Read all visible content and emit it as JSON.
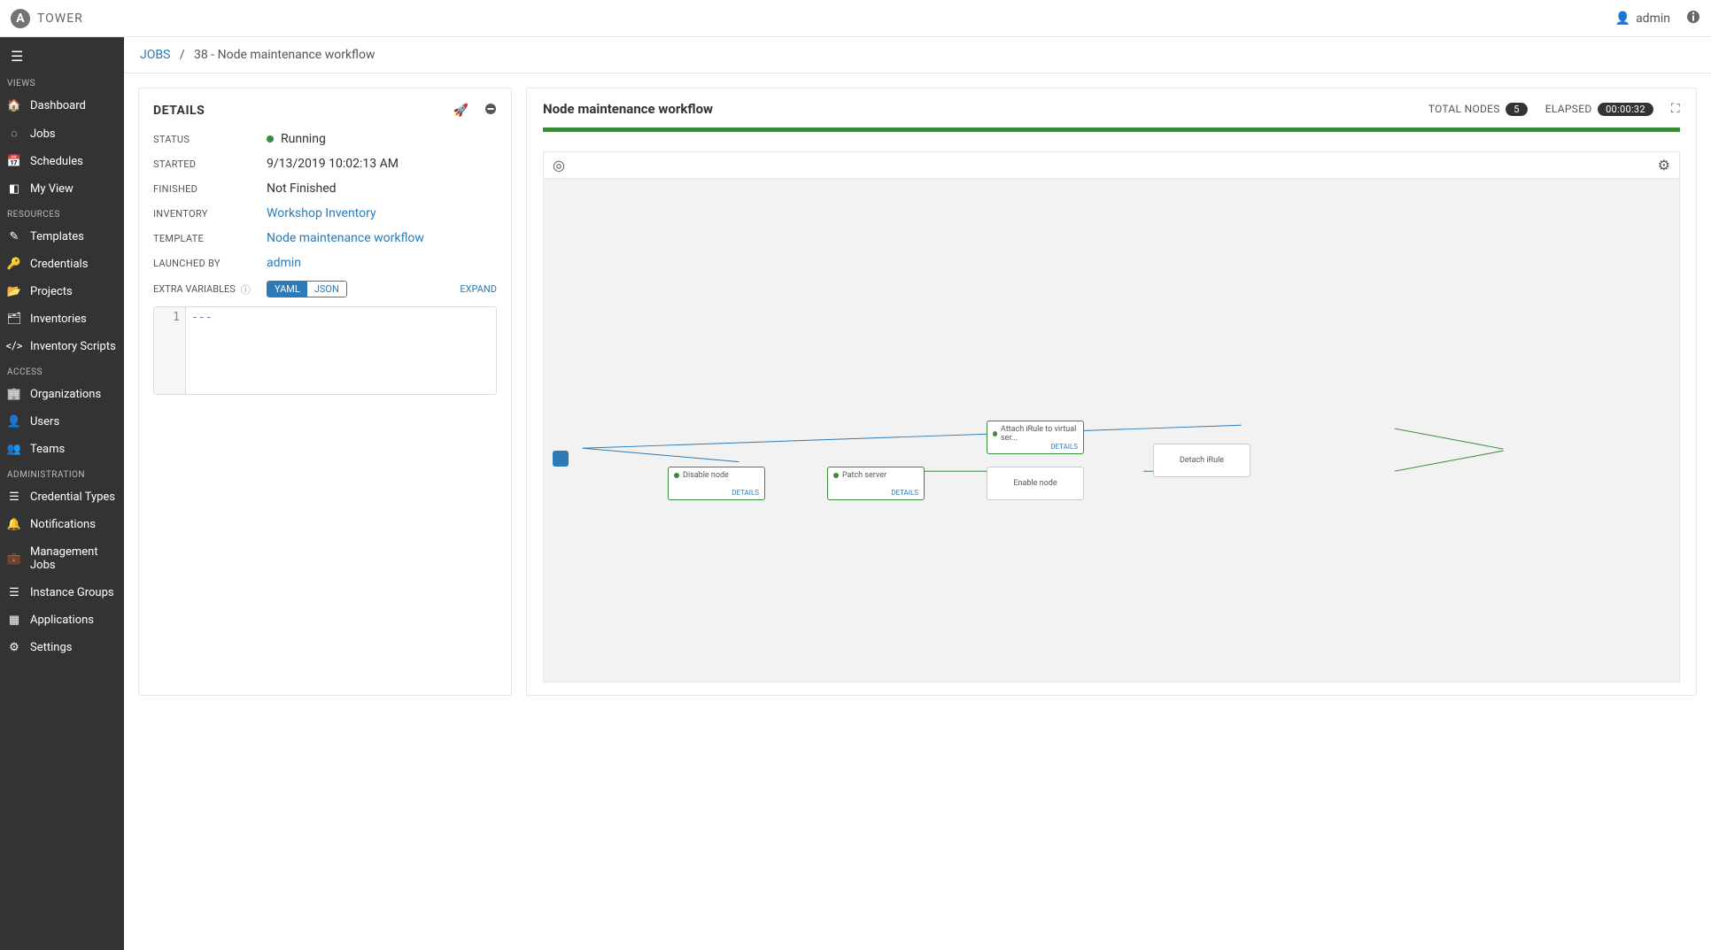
{
  "brand": "TOWER",
  "user": "admin",
  "sidebar": {
    "sections": {
      "views": "VIEWS",
      "resources": "RESOURCES",
      "access": "ACCESS",
      "administration": "ADMINISTRATION"
    },
    "items": {
      "dashboard": "Dashboard",
      "jobs": "Jobs",
      "schedules": "Schedules",
      "myview": "My View",
      "templates": "Templates",
      "credentials": "Credentials",
      "projects": "Projects",
      "inventories": "Inventories",
      "invscripts": "Inventory Scripts",
      "orgs": "Organizations",
      "users": "Users",
      "teams": "Teams",
      "credtypes": "Credential Types",
      "notifications": "Notifications",
      "mgmtjobs": "Management Jobs",
      "instgroups": "Instance Groups",
      "applications": "Applications",
      "settings": "Settings"
    }
  },
  "breadcrumb": {
    "jobs": "JOBS",
    "sep": "/",
    "current": "38 - Node maintenance workflow"
  },
  "details": {
    "title": "DETAILS",
    "labels": {
      "status": "STATUS",
      "started": "STARTED",
      "finished": "FINISHED",
      "inventory": "INVENTORY",
      "template": "TEMPLATE",
      "launched_by": "LAUNCHED BY",
      "extra_vars": "EXTRA VARIABLES"
    },
    "values": {
      "status": "Running",
      "started": "9/13/2019 10:02:13 AM",
      "finished": "Not Finished",
      "inventory": "Workshop Inventory",
      "template": "Node maintenance workflow",
      "launched_by": "admin"
    },
    "toggle": {
      "yaml": "YAML",
      "json": "JSON"
    },
    "expand": "EXPAND",
    "code_line_no": "1",
    "code_content": "---"
  },
  "workflow": {
    "title": "Node maintenance workflow",
    "total_nodes_label": "TOTAL NODES",
    "total_nodes": "5",
    "elapsed_label": "ELAPSED",
    "elapsed": "00:00:32",
    "details_label": "DETAILS",
    "nodes": {
      "disable": "Disable node",
      "patch": "Patch server",
      "attach": "Attach iRule to virtual ser...",
      "enable": "Enable node",
      "detach": "Detach iRule"
    }
  }
}
